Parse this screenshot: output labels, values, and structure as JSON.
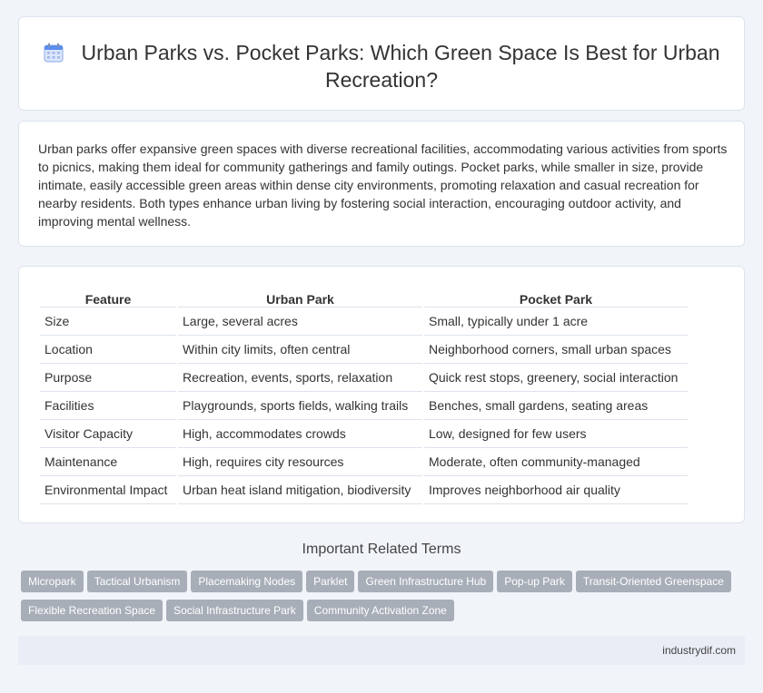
{
  "header": {
    "title": "Urban Parks vs. Pocket Parks: Which Green Space Is Best for Urban Recreation?",
    "icon": "calendar-icon"
  },
  "intro": {
    "text": "Urban parks offer expansive green spaces with diverse recreational facilities, accommodating various activities from sports to picnics, making them ideal for community gatherings and family outings. Pocket parks, while smaller in size, provide intimate, easily accessible green areas within dense city environments, promoting relaxation and casual recreation for nearby residents. Both types enhance urban living by fostering social interaction, encouraging outdoor activity, and improving mental wellness."
  },
  "table": {
    "headers": [
      "Feature",
      "Urban Park",
      "Pocket Park"
    ],
    "rows": [
      [
        "Size",
        "Large, several acres",
        "Small, typically under 1 acre"
      ],
      [
        "Location",
        "Within city limits, often central",
        "Neighborhood corners, small urban spaces"
      ],
      [
        "Purpose",
        "Recreation, events, sports, relaxation",
        "Quick rest stops, greenery, social interaction"
      ],
      [
        "Facilities",
        "Playgrounds, sports fields, walking trails",
        "Benches, small gardens, seating areas"
      ],
      [
        "Visitor Capacity",
        "High, accommodates crowds",
        "Low, designed for few users"
      ],
      [
        "Maintenance",
        "High, requires city resources",
        "Moderate, often community-managed"
      ],
      [
        "Environmental Impact",
        "Urban heat island mitigation, biodiversity",
        "Improves neighborhood air quality"
      ]
    ]
  },
  "terms": {
    "heading": "Important Related Terms",
    "items": [
      "Micropark",
      "Tactical Urbanism",
      "Placemaking Nodes",
      "Parklet",
      "Green Infrastructure Hub",
      "Pop-up Park",
      "Transit-Oriented Greenspace",
      "Flexible Recreation Space",
      "Social Infrastructure Park",
      "Community Activation Zone"
    ]
  },
  "footer": {
    "site": "industrydif.com"
  },
  "colors": {
    "tag_bg": "#a8aeb8",
    "page_bg": "#f1f4f9",
    "footer_bg": "#e9edf5",
    "icon_accent": "#5b8def"
  }
}
